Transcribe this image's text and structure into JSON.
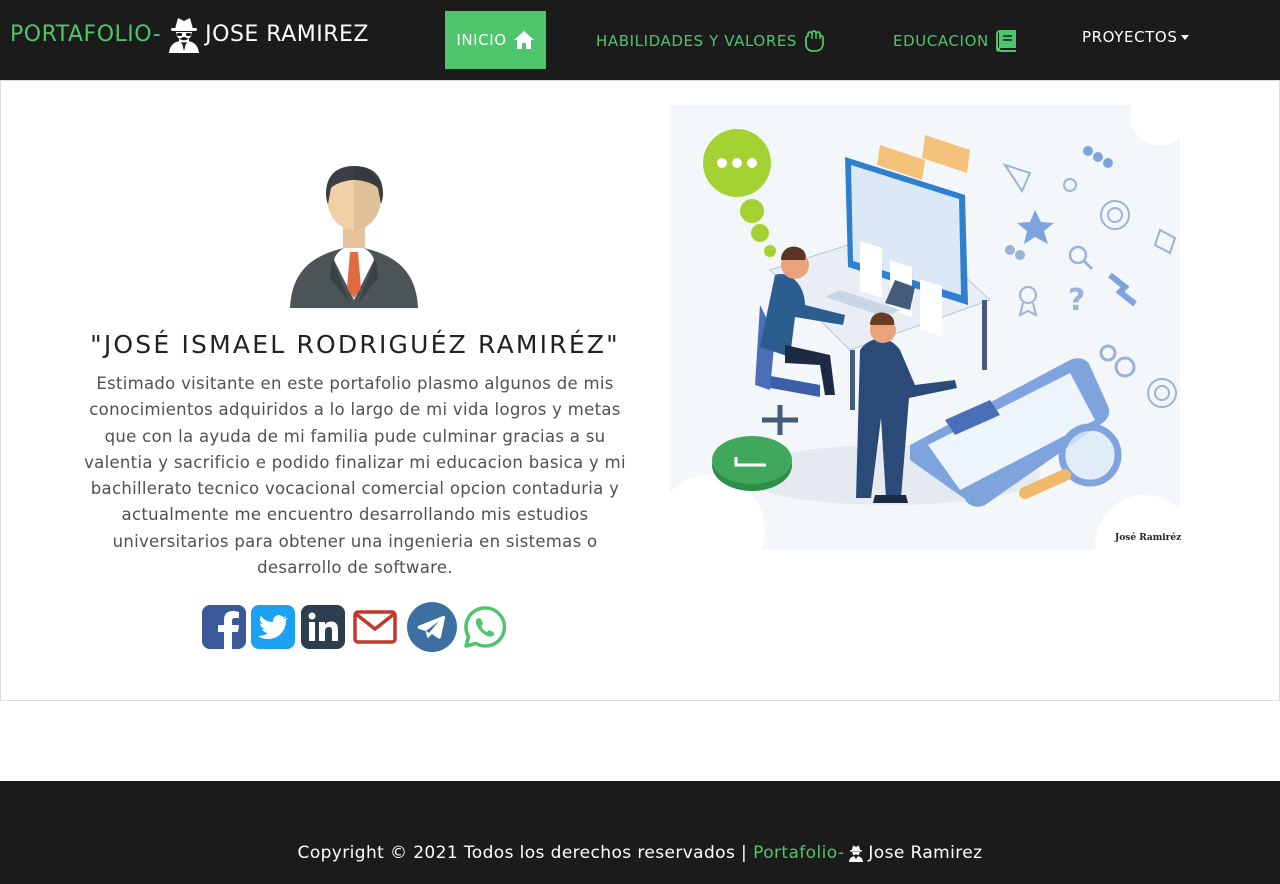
{
  "brand": {
    "prefix": "PORTAFOLIO-",
    "name": "JOSE RAMIREZ"
  },
  "nav": {
    "inicio": "INICIO",
    "habilidades": "HABILIDADES Y VALORES",
    "educacion": "EDUCACION",
    "proyectos": "PROYECTOS"
  },
  "icons": {
    "brand": "user-secret-icon",
    "inicio": "home-icon",
    "habilidades": "hand-rock-icon",
    "educacion": "book-icon",
    "proyectos": "caret-down-icon"
  },
  "profile": {
    "name": "\"JOSÉ ISMAEL RODRIGUÉZ RAMIRÉZ\"",
    "bio": "Estimado visitante en este portafolio plasmo algunos de mis conocimientos adquiridos a lo largo de mi vida logros y metas que con la ayuda de mi familia pude culminar gracias a su valentia y sacrificio e podido finalizar mi educacion basica y mi bachillerato tecnico vocacional comercial opcion contaduria y actualmente me encuentro desarrollando mis estudios universitarios para obtener una ingenieria en sistemas o desarrollo de software."
  },
  "socials": [
    {
      "icon": "facebook-icon",
      "color": "#3b5998"
    },
    {
      "icon": "twitter-icon",
      "color": "#1da1f2"
    },
    {
      "icon": "linkedin-icon",
      "color": "#2c3e50"
    },
    {
      "icon": "email-icon",
      "color": "#c0392b"
    },
    {
      "icon": "telegram-icon",
      "color": "#3d6fa0"
    },
    {
      "icon": "whatsapp-icon",
      "color": "#4ec46d"
    }
  ],
  "illustration": {
    "signature": "José Ramiréz"
  },
  "footer": {
    "copyright": "Copyright © 2021 Todos los derechos reservados |",
    "brand_prefix": "Portafolio-",
    "brand_name": "Jose Ramirez"
  },
  "colors": {
    "accent": "#4ec46d",
    "navbar_bg": "#1b1b1b",
    "text": "#505050"
  }
}
